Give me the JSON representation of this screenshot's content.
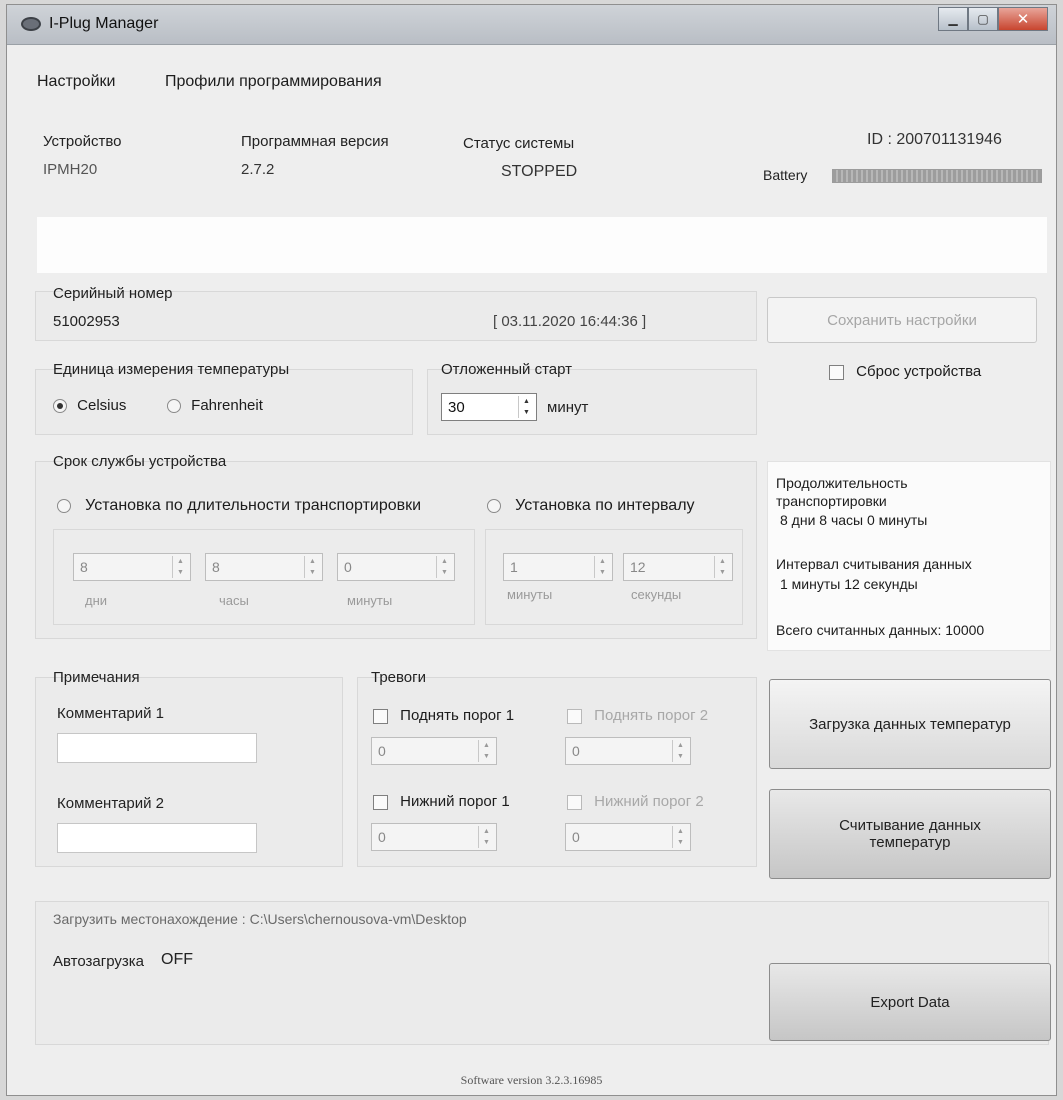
{
  "window": {
    "title": "I-Plug Manager"
  },
  "menu": {
    "items": [
      "Настройки",
      "Профили программирования"
    ]
  },
  "header": {
    "device_label": "Устройство",
    "device_value": "IPMH20",
    "fw_label": "Программная версия",
    "fw_value": "2.7.2",
    "status_label": "Статус системы",
    "status_value": "STOPPED",
    "id_text": "ID :  200701131946",
    "battery_label": "Battery",
    "battery_level": 1.0
  },
  "serial": {
    "label": "Серийный номер",
    "value": "51002953",
    "timestamp": "[ 03.11.2020 16:44:36 ]"
  },
  "save_button": "Сохранить настройки",
  "reset_label": "Сброс устройства",
  "temp_unit": {
    "label": "Единица измерения температуры",
    "celsius": "Celsius",
    "fahrenheit": "Fahrenheit",
    "selected": "Celsius"
  },
  "delayed_start": {
    "label": "Отложенный старт",
    "value": "30",
    "unit": "минут"
  },
  "lifetime": {
    "label": "Срок службы устройства",
    "opt_duration": "Установка по длительности транспортировки",
    "opt_interval": "Установка по интервалу",
    "days": "8",
    "days_label": "дни",
    "hours": "8",
    "hours_label": "часы",
    "minutes": "0",
    "minutes_label": "минуты",
    "int_minutes": "1",
    "int_minutes_label": "минуты",
    "int_seconds": "12",
    "int_seconds_label": "секунды"
  },
  "summary": {
    "duration_label": "Продолжительность транспортировки",
    "duration_value": "8 дни 8 часы 0 минуты",
    "interval_label": "Интервал считывания данных",
    "interval_value": "1 минуты 12 секунды",
    "total_label": "Всего считанных данных: 10000"
  },
  "notes": {
    "label": "Примечания",
    "comment1": "Комментарий 1",
    "comment2": "Комментарий 2"
  },
  "alarms": {
    "label": "Тревоги",
    "high1": "Поднять порог 1",
    "high2": "Поднять порог 2",
    "low1": "Нижний порог 1",
    "low2": "Нижний порог 2",
    "high1_value": "0",
    "high2_value": "0",
    "low1_value": "0",
    "low2_value": "0"
  },
  "buttons": {
    "load_temp": "Загрузка данных температур",
    "read_temp": "Считывание данных температур",
    "export": "Export Data"
  },
  "download": {
    "location": "Загрузить местонахождение : C:\\Users\\chernousova-vm\\Desktop",
    "auto_label": "Автозагрузка",
    "auto_value": "OFF"
  },
  "footer": "Software version 3.2.3.16985"
}
